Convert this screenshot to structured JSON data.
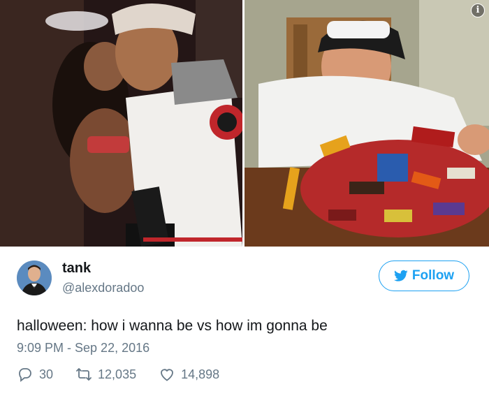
{
  "media": {
    "left_photo_alt": "",
    "right_photo_alt": "",
    "info_icon": "info-icon"
  },
  "author": {
    "display_name": "tank",
    "handle": "@alexdoradoo"
  },
  "follow": {
    "label": "Follow",
    "icon": "twitter-bird-icon",
    "color": "#1da1f2"
  },
  "tweet": {
    "text": "halloween: how i wanna be vs how im gonna be",
    "timestamp": "9:09 PM - Sep 22, 2016"
  },
  "actions": {
    "replies": "30",
    "retweets": "12,035",
    "likes": "14,898"
  },
  "colors": {
    "text_primary": "#14171a",
    "text_secondary": "#657786",
    "accent": "#1da1f2"
  }
}
